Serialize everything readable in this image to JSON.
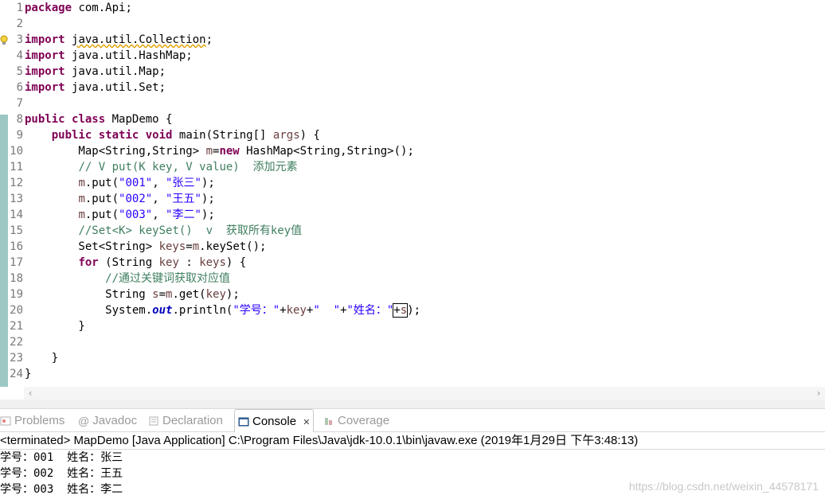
{
  "editor": {
    "line_numbers": [
      "1",
      "2",
      "3",
      "4",
      "5",
      "6",
      "7",
      "8",
      "9",
      "10",
      "11",
      "12",
      "13",
      "14",
      "15",
      "16",
      "17",
      "18",
      "19",
      "20",
      "21",
      "22",
      "23",
      "24"
    ],
    "code": {
      "l1_kw": "package",
      "l1_rest": " com.Api;",
      "l3_kw": "import",
      "l3_sp": " ",
      "l3_rest": "java.util.Collection",
      "l3_end": ";",
      "l4_kw": "import",
      "l4_rest": " java.util.HashMap;",
      "l5_kw": "import",
      "l5_rest": " java.util.Map;",
      "l6_kw": "import",
      "l6_rest": " java.util.Set;",
      "l8_kw1": "public",
      "l8_sp": " ",
      "l8_kw2": "class",
      "l8_rest": " MapDemo {",
      "l9_ind": "    ",
      "l9_kw1": "public",
      "l9_sp1": " ",
      "l9_kw2": "static",
      "l9_sp2": " ",
      "l9_kw3": "void",
      "l9_mid": " main(String[] ",
      "l9_var": "args",
      "l9_end": ") {",
      "l10_a": "        Map<String,String> ",
      "l10_var": "m",
      "l10_b": "=",
      "l10_kw": "new",
      "l10_c": " HashMap<String,String>();",
      "l11_ind": "        ",
      "l11_cm": "// V put(K key, V value)  添加元素",
      "l12_a": "        ",
      "l12_var": "m",
      "l12_b": ".put(",
      "l12_s1": "\"001\"",
      "l12_c": ", ",
      "l12_s2": "\"张三\"",
      "l12_d": ");",
      "l13_a": "        ",
      "l13_var": "m",
      "l13_b": ".put(",
      "l13_s1": "\"002\"",
      "l13_c": ", ",
      "l13_s2": "\"王五\"",
      "l13_d": ");",
      "l14_a": "        ",
      "l14_var": "m",
      "l14_b": ".put(",
      "l14_s1": "\"003\"",
      "l14_c": ", ",
      "l14_s2": "\"李二\"",
      "l14_d": ");",
      "l15_ind": "        ",
      "l15_cm": "//Set<K> keySet()  v  获取所有key值",
      "l16_a": "        Set<String> ",
      "l16_var1": "keys",
      "l16_b": "=",
      "l16_var2": "m",
      "l16_c": ".keySet();",
      "l17_ind": "        ",
      "l17_kw": "for",
      "l17_a": " (String ",
      "l17_var1": "key",
      "l17_b": " : ",
      "l17_var2": "keys",
      "l17_c": ") {",
      "l18_ind": "            ",
      "l18_cm": "//通过关键词获取对应值",
      "l19_a": "            String ",
      "l19_var1": "s",
      "l19_b": "=",
      "l19_var2": "m",
      "l19_c": ".get(",
      "l19_var3": "key",
      "l19_d": ");",
      "l20_a": "            System.",
      "l20_fd": "out",
      "l20_b": ".println(",
      "l20_s1": "\"学号：\"",
      "l20_c": "+",
      "l20_var1": "key",
      "l20_d": "+",
      "l20_s2": "\"  \"",
      "l20_e": "+",
      "l20_s3": "\"姓名：\"",
      "l20_f": "+",
      "l20_var2": "s",
      "l20_g": ");",
      "l21": "        }",
      "l23": "    }",
      "l24": "}"
    }
  },
  "scrollbar": {
    "left_arrow": "‹",
    "right_arrow": "›"
  },
  "tabs": [
    {
      "label": "Problems",
      "active": false
    },
    {
      "label": "Javadoc",
      "active": false
    },
    {
      "label": "Declaration",
      "active": false
    },
    {
      "label": "Console",
      "active": true,
      "close": "✕"
    },
    {
      "label": "Coverage",
      "active": false
    }
  ],
  "console": {
    "status": "<terminated> MapDemo [Java Application] C:\\Program Files\\Java\\jdk-10.0.1\\bin\\javaw.exe (2019年1月29日 下午3:48:13)",
    "lines": [
      "学号：001  姓名：张三",
      "学号：002  姓名：王五",
      "学号：003  姓名：李二"
    ],
    "watermark": "https://blog.csdn.net/weixin_44578171"
  },
  "colors": {
    "keyword": "#7f0055",
    "string": "#2a00ff",
    "comment": "#3f7f5f",
    "variable": "#6a3e3e",
    "field": "#0000c0",
    "ruler": "#9cc8c3"
  },
  "icons": {
    "warning": "warning-lightbulb-icon",
    "problems": "problems-icon",
    "javadoc": "javadoc-at-icon",
    "declaration": "declaration-icon",
    "console": "console-icon",
    "coverage": "coverage-icon"
  }
}
